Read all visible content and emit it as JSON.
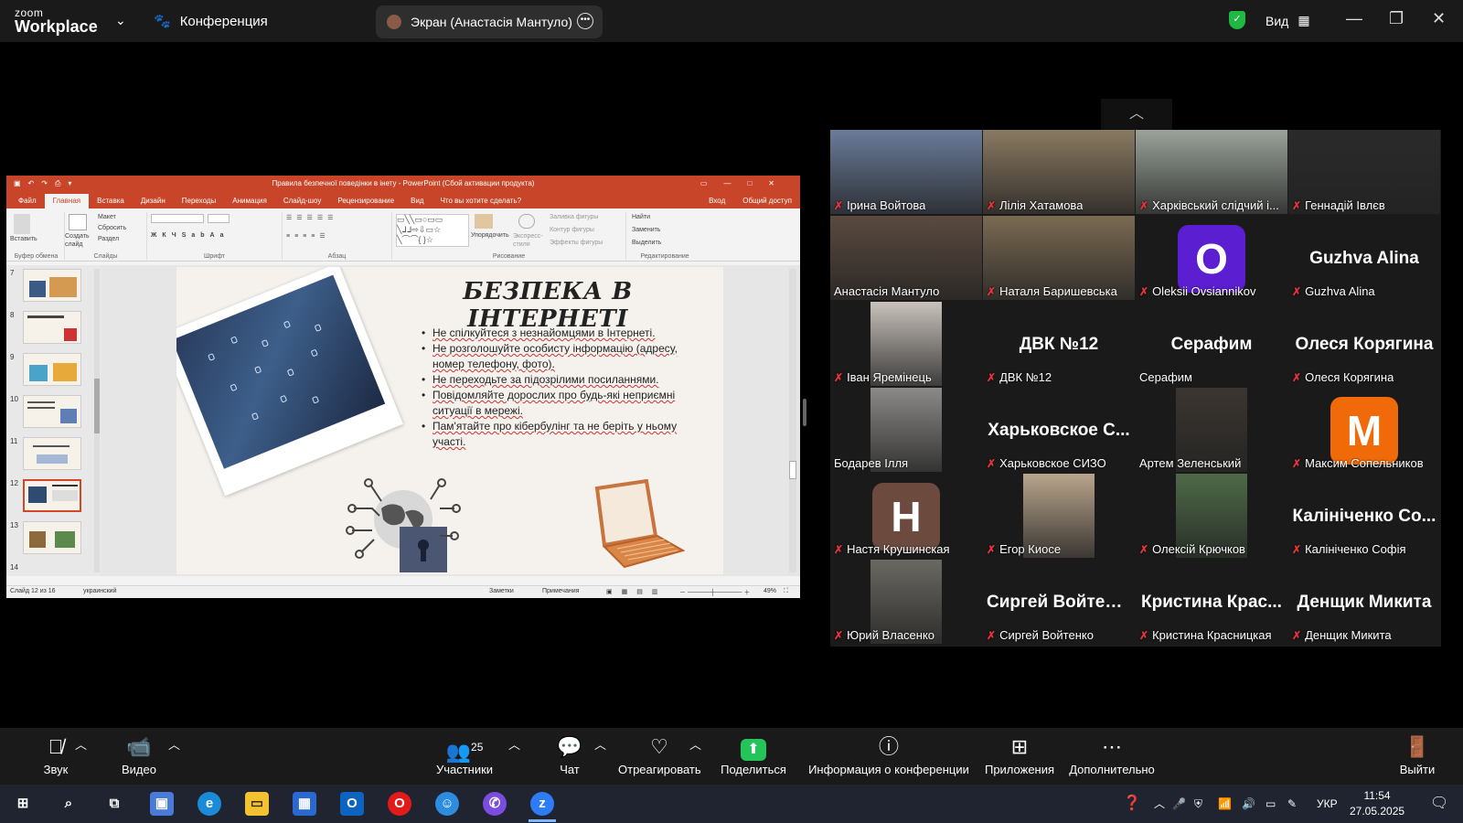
{
  "zoom": {
    "logo_line1": "zoom",
    "logo_line2": "Workplace",
    "meeting_title": "Конференция",
    "screen_share_label": "Экран (Анастасія Мантуло)",
    "view_label": "Вид"
  },
  "ppt": {
    "window_title": "Правила безпечної поведінки в інету - PowerPoint (Сбой активации продукта)",
    "tabs": [
      "Файл",
      "Главная",
      "Вставка",
      "Дизайн",
      "Переходы",
      "Анимация",
      "Слайд-шоу",
      "Рецензирование",
      "Вид",
      "Что вы хотите сделать?"
    ],
    "tabs_right": [
      "Вход",
      "Общий доступ"
    ],
    "groups": [
      "Буфер обмена",
      "Слайды",
      "Шрифт",
      "Абзац",
      "Рисование",
      "Редактирование"
    ],
    "ribbon_labels": {
      "paste": "Вставить",
      "new_slide": "Создать слайд",
      "layout": "Макет",
      "reset": "Сбросить",
      "section": "Раздел",
      "arrange": "Упорядочить",
      "quick_styles": "Экспресс-стили",
      "fill": "Заливка фигуры",
      "outline": "Контур фигуры",
      "effects": "Эффекты фигуры",
      "find": "Найти",
      "replace": "Заменить",
      "select": "Выделить"
    },
    "thumbnail_numbers": [
      "7",
      "8",
      "9",
      "10",
      "11",
      "12",
      "13",
      "14"
    ],
    "selected_slide": "12",
    "slide": {
      "title": "БЕЗПЕКА В ІНТЕРНЕТІ",
      "bullets": [
        "Не спілкуйтеся з незнайомцями в Інтернеті.",
        "Не розголошуйте особисту інформацію (адресу, номер телефону, фото).",
        "Не переходьте за підозрілими посиланнями.",
        "Повідомляйте дорослих про будь-які неприємні ситуації в мережі.",
        "Пам'ятайте про кібербулінг та не беріть у ньому участі."
      ]
    },
    "status": {
      "slide_count": "Слайд 12 из 16",
      "language": "украинский",
      "notes": "Заметки",
      "comments": "Примечания",
      "zoom": "49%"
    }
  },
  "participants": [
    {
      "name": "Ірина Войтова",
      "muted": true,
      "type": "video",
      "color": "#6b7c9a"
    },
    {
      "name": "Лілія Хатамова",
      "muted": true,
      "type": "video",
      "color": "#8a7a62"
    },
    {
      "name": "Харківський слідчий і...",
      "muted": true,
      "type": "video",
      "color": "#9aa39a"
    },
    {
      "name": "Геннадій Івлєв",
      "muted": true,
      "type": "video",
      "color": "#2a2a2a"
    },
    {
      "name": "Анастасія Мантуло",
      "muted": false,
      "type": "video",
      "color": "#5a4a40",
      "active": true
    },
    {
      "name": "Наталя Баришевська",
      "muted": true,
      "type": "video",
      "color": "#7a6a52"
    },
    {
      "name": "Oleksii Ovsiannikov",
      "muted": true,
      "type": "avatar",
      "letter": "O",
      "color": "#5b1fd1"
    },
    {
      "name": "Guzhva Alina",
      "muted": true,
      "type": "name",
      "big": "Guzhva Alina"
    },
    {
      "name": "Іван Яремінець",
      "muted": true,
      "type": "video",
      "color": "#c9c2bc"
    },
    {
      "name": "ДВК №12",
      "muted": true,
      "type": "name",
      "big": "ДВК №12"
    },
    {
      "name": "Серафим",
      "muted": false,
      "type": "name",
      "big": "Серафим"
    },
    {
      "name": "Олеся Корягина",
      "muted": true,
      "type": "name",
      "big": "Олеся Корягина"
    },
    {
      "name": "Бодарев Ілля",
      "muted": false,
      "type": "video",
      "color": "#8c8a88"
    },
    {
      "name": "Харьковское СИЗО",
      "muted": true,
      "type": "name",
      "big": "Харьковское С..."
    },
    {
      "name": "Артем Зеленський",
      "muted": false,
      "type": "video",
      "color": "#3a3530"
    },
    {
      "name": "Максим Сопельников",
      "muted": true,
      "type": "avatar",
      "letter": "M",
      "color": "#f06a0a"
    },
    {
      "name": "Настя Крушинская",
      "muted": true,
      "type": "avatar",
      "letter": "H",
      "color": "#6d4a3e"
    },
    {
      "name": "Егор Киосе",
      "muted": true,
      "type": "video",
      "color": "#b9a58c"
    },
    {
      "name": "Олексій Крючков",
      "muted": true,
      "type": "video",
      "color": "#4f6a48"
    },
    {
      "name": "Калініченко Софія",
      "muted": true,
      "type": "name",
      "big": "Калініченко Со..."
    },
    {
      "name": "Юрий Власенко",
      "muted": true,
      "type": "video",
      "color": "#6a6862"
    },
    {
      "name": "Сиргей Войтенко",
      "muted": true,
      "type": "name",
      "big": "Сиргей Войтенко"
    },
    {
      "name": "Кристина Красницкая",
      "muted": true,
      "type": "name",
      "big": "Кристина Крас..."
    },
    {
      "name": "Денщик Микита",
      "muted": true,
      "type": "name",
      "big": "Денщик Микита"
    }
  ],
  "toolbar": {
    "audio": "Звук",
    "video": "Видео",
    "participants": "Участники",
    "participants_count": "25",
    "chat": "Чат",
    "react": "Отреагировать",
    "share": "Поделиться",
    "info": "Информация о конференции",
    "apps": "Приложения",
    "more": "Дополнительно",
    "leave": "Выйти"
  },
  "taskbar": {
    "lang": "УКР",
    "time": "11:54",
    "date": "27.05.2025"
  }
}
